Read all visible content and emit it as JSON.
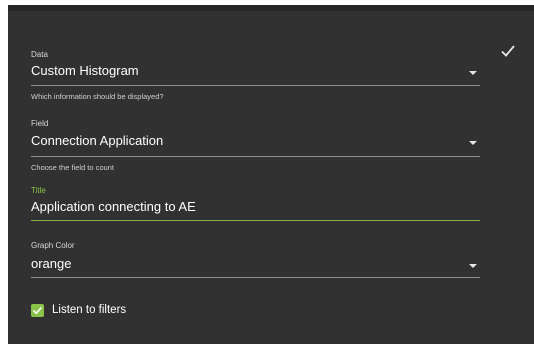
{
  "form": {
    "data": {
      "label": "Data",
      "value": "Custom Histogram",
      "helper": "Which information should be displayed?",
      "icon": "chevron-down-icon"
    },
    "field": {
      "label": "Field",
      "value": "Connection Application",
      "helper": "Choose the field to count",
      "icon": "chevron-down-icon"
    },
    "title": {
      "label": "Title",
      "value": "Application connecting to AE"
    },
    "graph_color": {
      "label": "Graph Color",
      "value": "orange",
      "icon": "chevron-down-icon"
    },
    "listen_filters": {
      "label": "Listen to filters",
      "checked": true
    }
  },
  "actions": {
    "confirm_icon": "check-icon"
  },
  "colors": {
    "panel_background": "#313131",
    "panel_top_bar": "#262626",
    "accent_green": "#8bc34a",
    "underline": "#8f8f8f",
    "text": "#ffffff"
  }
}
